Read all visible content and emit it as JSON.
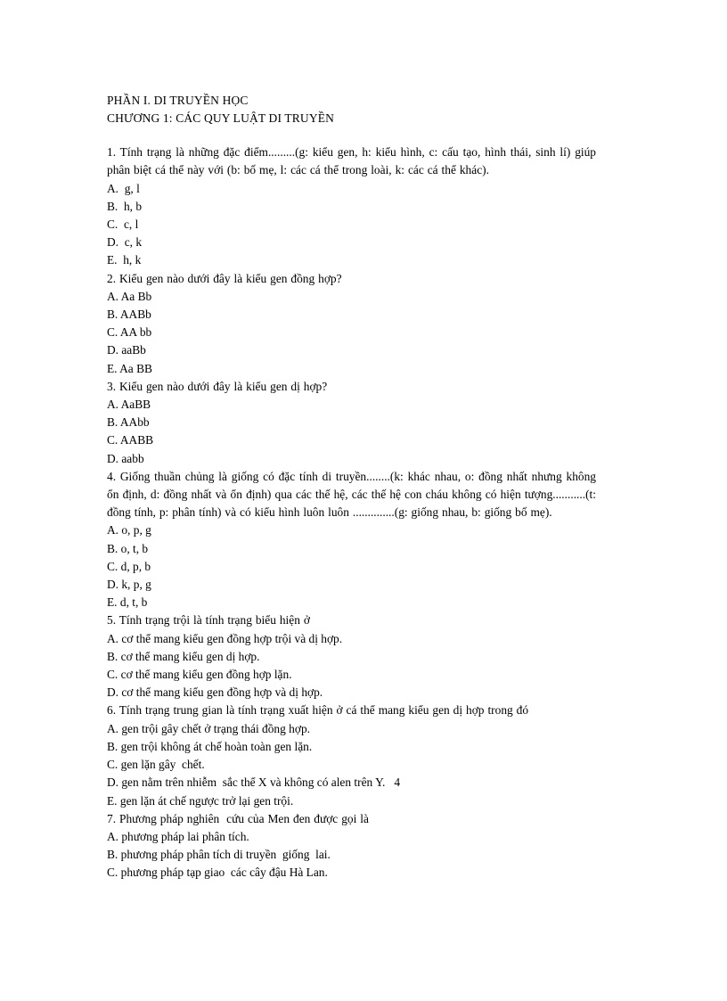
{
  "document": {
    "headings": [
      "PHẦN I. DI TRUYỀN HỌC",
      "CHƯƠNG 1: CÁC QUY LUẬT DI TRUYỀN"
    ],
    "questions": [
      {
        "stem": "1. Tính trạng là những đặc điểm.........(g: kiểu gen,  h: kiểu hình,  c: cấu tạo, hình thái, sinh lí) giúp phân biệt cá thể này với (b: bố mẹ,  l: các cá thể trong loài, k: các cá thể khác).",
        "multiline": true,
        "options": [
          "A.  g, l",
          "B.  h, b",
          "C.  c, l",
          "D.  c, k",
          "E.  h, k"
        ]
      },
      {
        "stem": "2. Kiểu gen nào dưới đây là kiểu gen đồng hợp?",
        "multiline": false,
        "options": [
          "A. Aa Bb",
          "B. AABb",
          "C. AA bb",
          "D. aaBb",
          "E. Aa BB"
        ]
      },
      {
        "stem": "3. Kiểu gen nào dưới đây là kiểu gen dị hợp?",
        "multiline": false,
        "options": [
          "A. AaBB",
          "B. AAbb",
          "C. AABB",
          "D. aabb"
        ]
      },
      {
        "stem": "4. Giống thuần chủng là giống có đặc tính di truyền........(k:  khác nhau, o: đồng nhất nhưng không ổn định, d: đồng nhất và ổn định) qua các thế hệ, các thế hệ con cháu không có hiện tượng...........(t:  đồng tính, p: phân tính) và có kiểu hình luôn luôn ..............(g: giống nhau, b: giống bố mẹ).",
        "multiline": true,
        "options": [
          "A. o, p, g",
          "B. o, t, b",
          "C. d, p, b",
          "D. k, p, g",
          "E. d, t, b"
        ]
      },
      {
        "stem": "5. Tính trạng trội là tính trạng biểu hiện ở",
        "multiline": false,
        "options": [
          "A. cơ thể mang kiểu gen đồng hợp trội và dị hợp.",
          "B. cơ thể mang kiểu gen dị hợp.",
          "C. cơ thể mang kiểu gen đồng hợp lặn.",
          "D. cơ thể mang kiểu gen đồng hợp và dị hợp."
        ]
      },
      {
        "stem": "6. Tính trạng trung gian là tính trạng xuất hiện ở cá thể mang kiểu gen dị hợp trong đó",
        "multiline": false,
        "options": [
          "A. gen trội gây chết ở trạng thái đồng hợp.",
          "B. gen trội không át chế hoàn toàn gen lặn.",
          "C. gen lặn gây  chết.",
          "D. gen nằm trên nhiễm  sắc thể X và không có alen trên Y.   4",
          "E. gen lặn át chế ngược trở lại gen trội."
        ]
      },
      {
        "stem": "7. Phương pháp nghiên  cứu của Men đen được gọi là",
        "multiline": false,
        "options": [
          "A. phương pháp lai phân tích.",
          "B. phương pháp phân tích di truyền  giống  lai.",
          "C. phương pháp tạp giao  các cây đậu Hà Lan."
        ]
      }
    ]
  }
}
